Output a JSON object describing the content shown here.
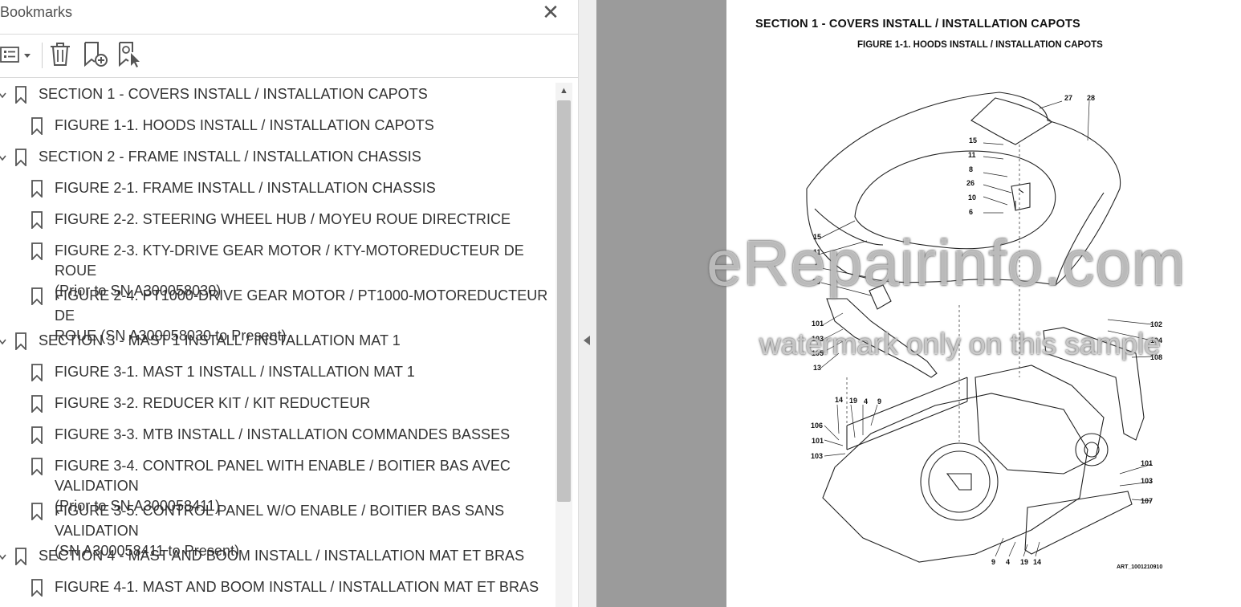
{
  "bookmarks_panel": {
    "title": "Bookmarks",
    "close_glyph": "✕",
    "toolbar": [
      {
        "name": "options-menu",
        "icon": "list-options-icon"
      },
      {
        "name": "delete-bookmark",
        "icon": "trash-icon"
      },
      {
        "name": "new-bookmark",
        "icon": "bookmark-add-icon"
      },
      {
        "name": "bookmark-from-selection",
        "icon": "bookmark-search-icon"
      }
    ],
    "items": [
      {
        "level": 0,
        "expanded": true,
        "label": "SECTION 1 - COVERS INSTALL / INSTALLATION CAPOTS"
      },
      {
        "level": 1,
        "label": "FIGURE 1-1. HOODS INSTALL / INSTALLATION CAPOTS"
      },
      {
        "level": 0,
        "expanded": true,
        "label": "SECTION 2 - FRAME INSTALL / INSTALLATION CHASSIS"
      },
      {
        "level": 1,
        "label": "FIGURE 2-1. FRAME INSTALL / INSTALLATION CHASSIS"
      },
      {
        "level": 1,
        "label": "FIGURE 2-2. STEERING WHEEL HUB / MOYEU ROUE DIRECTRICE"
      },
      {
        "level": 1,
        "label": "FIGURE 2-3. KTY-DRIVE GEAR MOTOR / KTY-MOTOREDUCTEUR DE ROUE\n(Prior to SN A300058030)"
      },
      {
        "level": 1,
        "label": "FIGURE 2-4. PT1000-DRIVE GEAR MOTOR / PT1000-MOTOREDUCTEUR DE\nROUE (SN A300058030 to Present)"
      },
      {
        "level": 0,
        "expanded": true,
        "label": "SECTION 3 - MAST 1 INSTALL / INSTALLATION MAT 1"
      },
      {
        "level": 1,
        "label": "FIGURE 3-1. MAST 1 INSTALL / INSTALLATION MAT 1"
      },
      {
        "level": 1,
        "label": "FIGURE 3-2. REDUCER KIT / KIT REDUCTEUR"
      },
      {
        "level": 1,
        "label": "FIGURE 3-3. MTB INSTALL / INSTALLATION COMMANDES BASSES"
      },
      {
        "level": 1,
        "label": "FIGURE 3-4. CONTROL PANEL WITH ENABLE / BOITIER BAS AVEC VALIDATION\n(Prior to SN A300058411)"
      },
      {
        "level": 1,
        "label": "FIGURE 3-5. CONTROL PANEL W/O ENABLE / BOITIER BAS SANS VALIDATION\n(SN A300058411 to Present)"
      },
      {
        "level": 0,
        "expanded": true,
        "label": "SECTION 4 - MAST AND BOOM INSTALL / INSTALLATION MAT ET BRAS"
      },
      {
        "level": 1,
        "label": "FIGURE 4-1. MAST AND BOOM INSTALL / INSTALLATION MAT ET BRAS"
      }
    ]
  },
  "document": {
    "section_title": "SECTION 1 - COVERS INSTALL / INSTALLATION CAPOTS",
    "figure_title": "FIGURE 1-1. HOODS INSTALL / INSTALLATION CAPOTS",
    "art_code": "ART_1001210910",
    "callouts": [
      "27",
      "28",
      "15",
      "11",
      "8",
      "26",
      "10",
      "6",
      "15",
      "11",
      "8",
      "25",
      "101",
      "103",
      "105",
      "13",
      "102",
      "104",
      "108",
      "14",
      "19",
      "4",
      "9",
      "106",
      "101",
      "103",
      "101",
      "103",
      "107",
      "9",
      "4",
      "19",
      "14"
    ]
  },
  "watermark": {
    "line1": "eRepairinfo.com",
    "line2": "watermark only on this sample"
  },
  "colors": {
    "panel_bg": "#ffffff",
    "viewer_bg": "#9b9b9b",
    "text": "#333333"
  }
}
